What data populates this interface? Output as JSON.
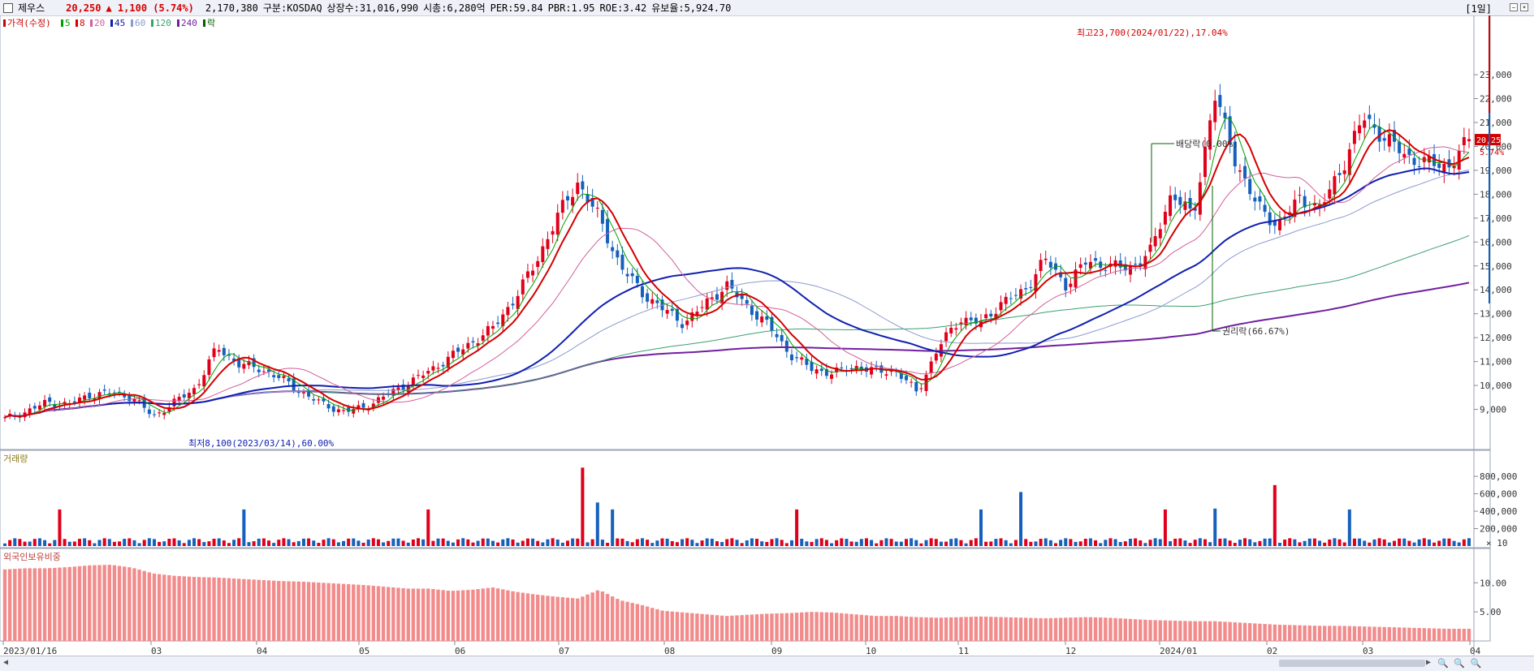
{
  "header": {
    "stock_name": "제우스",
    "price": "20,250",
    "change": "▲ 1,100 (5.74%)",
    "volume": "2,170,380",
    "market": "구분:KOSDAQ",
    "shares": "상장수:31,016,990",
    "mktcap": "시총:6,280억",
    "per": "PER:59.84",
    "pbr": "PBR:1.95",
    "roe": "ROE:3.42",
    "float": "유보율:5,924.70",
    "period": "[1일]",
    "colors": {
      "up": "#e0001b",
      "down": "#1560bd",
      "label_up": "#d40000"
    }
  },
  "panels": {
    "price_legend": [
      {
        "text": "가격(수정)",
        "color": "#cc0000"
      },
      {
        "text": "5",
        "color": "#00a000"
      },
      {
        "text": "8",
        "color": "#d40000"
      },
      {
        "text": "20",
        "color": "#d05f9a"
      },
      {
        "text": "45",
        "color": "#1020b0"
      },
      {
        "text": "60",
        "color": "#8a9ad0"
      },
      {
        "text": "120",
        "color": "#3aa070"
      },
      {
        "text": "240",
        "color": "#7020a0"
      },
      {
        "text": "락",
        "color": "#006000"
      }
    ],
    "volume_title": "거래량",
    "foreign_title": "외국인보유비중",
    "volume_multiplier": "× 10"
  },
  "chart_data": {
    "type": "candlestick",
    "x_labels": [
      "2023/01/16",
      "03",
      "04",
      "05",
      "06",
      "07",
      "08",
      "09",
      "10",
      "11",
      "12",
      "2024/01",
      "02",
      "03",
      "04"
    ],
    "price_axis": {
      "ylim": [
        8000,
        24800
      ],
      "ticks": [
        9000,
        10000,
        11000,
        12000,
        13000,
        14000,
        15000,
        16000,
        17000,
        18000,
        19000,
        20000,
        21000,
        22000,
        23000
      ]
    },
    "price_keypoints": [
      8600,
      8900,
      9300,
      9200,
      9600,
      9700,
      9500,
      8700,
      9300,
      9900,
      11600,
      10900,
      10700,
      10300,
      9700,
      9200,
      8900,
      9100,
      9600,
      10100,
      10600,
      11200,
      11800,
      12400,
      13600,
      15100,
      17000,
      18500,
      17000,
      15000,
      13900,
      13200,
      12600,
      13400,
      14200,
      13300,
      12500,
      11300,
      10700,
      10500,
      10800,
      10600,
      10600,
      9700,
      11600,
      12800,
      12600,
      13500,
      13900,
      15300,
      14200,
      15200,
      15000,
      14900,
      15600,
      18100,
      17000,
      22200,
      19400,
      17500,
      16700,
      17800,
      17400,
      19100,
      21200,
      20400,
      19600,
      19300,
      19150,
      20250
    ],
    "volume_axis": {
      "ticks": [
        "200,000",
        "400,000",
        "600,000",
        "800,000"
      ]
    },
    "foreign_axis": {
      "ticks": [
        "5.00",
        "10.00"
      ]
    },
    "foreign_keypoints": [
      12.3,
      12.5,
      12.5,
      12.7,
      13.0,
      13.1,
      12.6,
      11.6,
      11.2,
      11.0,
      10.9,
      10.7,
      10.5,
      10.3,
      10.2,
      10.0,
      9.8,
      9.6,
      9.3,
      9.0,
      9.0,
      8.6,
      8.8,
      9.2,
      8.5,
      8.0,
      7.6,
      7.3,
      8.8,
      7.0,
      6.2,
      5.2,
      4.9,
      4.6,
      4.3,
      4.5,
      4.7,
      4.8,
      5.0,
      4.9,
      4.6,
      4.3,
      4.3,
      4.1,
      4.0,
      4.1,
      4.2,
      4.1,
      4.0,
      3.9,
      4.0,
      4.1,
      4.0,
      3.8,
      3.6,
      3.5,
      3.4,
      3.4,
      3.2,
      3.0,
      2.8,
      2.7,
      2.6,
      2.6,
      2.5,
      2.4,
      2.3,
      2.2,
      2.1,
      2.1
    ],
    "annotations": {
      "high": "최고23,700(2024/01/22),17.04%",
      "low": "최저8,100(2023/03/14),60.00%",
      "dividend": "배당락(0.00%)",
      "rights": "권리락(66.67%)"
    },
    "last_price_label": "20,250",
    "last_pct_label": "5.74%"
  },
  "bottom_controls": {
    "left": "◀",
    "right": "▶",
    "zoom": "🔍 🔍 🔍"
  }
}
